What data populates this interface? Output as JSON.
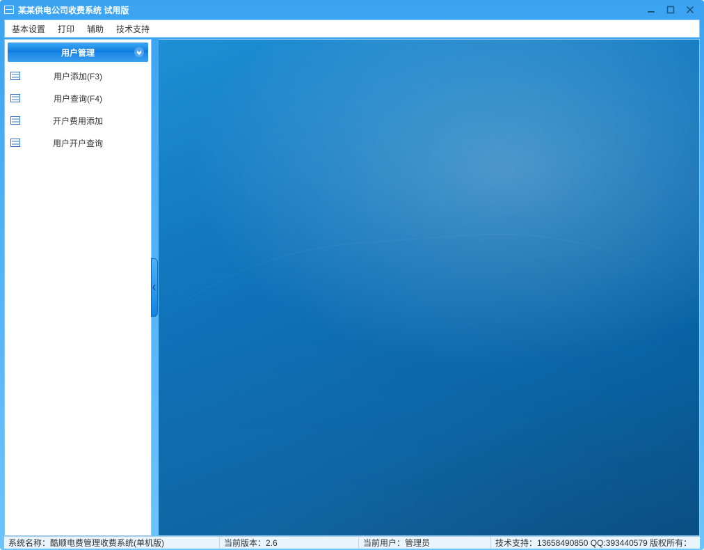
{
  "window": {
    "title": "某某供电公司收费系统 试用版"
  },
  "menubar": {
    "items": [
      "基本设置",
      "打印",
      "辅助",
      "技术支持"
    ]
  },
  "sidebar": {
    "header_label": "用户管理",
    "items": [
      {
        "label": "用户添加(F3)"
      },
      {
        "label": "用户查询(F4)"
      },
      {
        "label": "开户费用添加"
      },
      {
        "label": "用户开户查询"
      }
    ]
  },
  "status": {
    "system_name_label": "系统名称：",
    "system_name_value": "酷顺电费管理收费系统(单机版)",
    "version_label": "当前版本：",
    "version_value": "2.6",
    "user_label": "当前用户：",
    "user_value": "管理员",
    "support_label": "技术支持：",
    "support_value": "13658490850 QQ:393440579 版权所有："
  }
}
